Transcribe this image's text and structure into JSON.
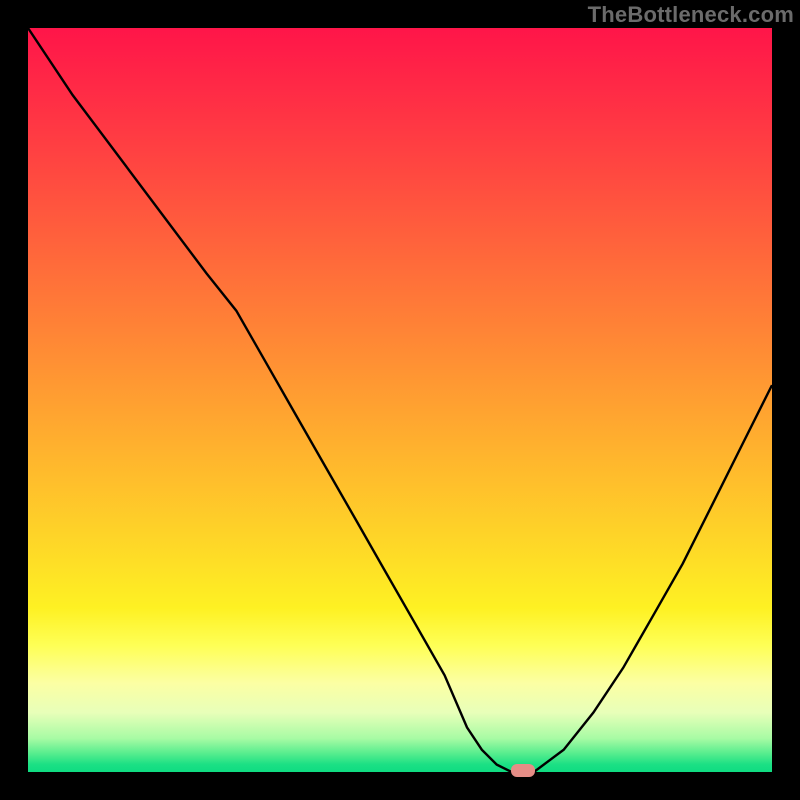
{
  "watermark": "TheBottleneck.com",
  "colors": {
    "page_bg": "#000000",
    "curve": "#000000",
    "marker": "#e58d86"
  },
  "gradient_stops": [
    {
      "offset": 0.0,
      "color": "#ff1549"
    },
    {
      "offset": 0.1,
      "color": "#ff2f45"
    },
    {
      "offset": 0.2,
      "color": "#ff4a40"
    },
    {
      "offset": 0.3,
      "color": "#ff663b"
    },
    {
      "offset": 0.4,
      "color": "#ff8236"
    },
    {
      "offset": 0.5,
      "color": "#ff9f31"
    },
    {
      "offset": 0.6,
      "color": "#ffbc2c"
    },
    {
      "offset": 0.7,
      "color": "#fed927"
    },
    {
      "offset": 0.78,
      "color": "#fef123"
    },
    {
      "offset": 0.83,
      "color": "#feff56"
    },
    {
      "offset": 0.88,
      "color": "#fcffa3"
    },
    {
      "offset": 0.92,
      "color": "#e8ffb9"
    },
    {
      "offset": 0.955,
      "color": "#a7fba4"
    },
    {
      "offset": 0.975,
      "color": "#57ed8e"
    },
    {
      "offset": 0.99,
      "color": "#1be084"
    },
    {
      "offset": 1.0,
      "color": "#0fdc82"
    }
  ],
  "chart_data": {
    "type": "line",
    "title": "",
    "xlabel": "",
    "ylabel": "",
    "xlim": [
      0,
      100
    ],
    "ylim": [
      0,
      100
    ],
    "series": [
      {
        "name": "bottleneck-curve",
        "x": [
          0,
          6,
          12,
          18,
          24,
          28,
          32,
          36,
          40,
          44,
          48,
          52,
          56,
          59,
          61,
          63,
          65,
          68,
          72,
          76,
          80,
          84,
          88,
          92,
          96,
          100
        ],
        "values": [
          100,
          91,
          83,
          75,
          67,
          62,
          55,
          48,
          41,
          34,
          27,
          20,
          13,
          6,
          3,
          1,
          0,
          0,
          3,
          8,
          14,
          21,
          28,
          36,
          44,
          52
        ]
      }
    ],
    "marker": {
      "x": 66.5,
      "y": 0
    }
  }
}
